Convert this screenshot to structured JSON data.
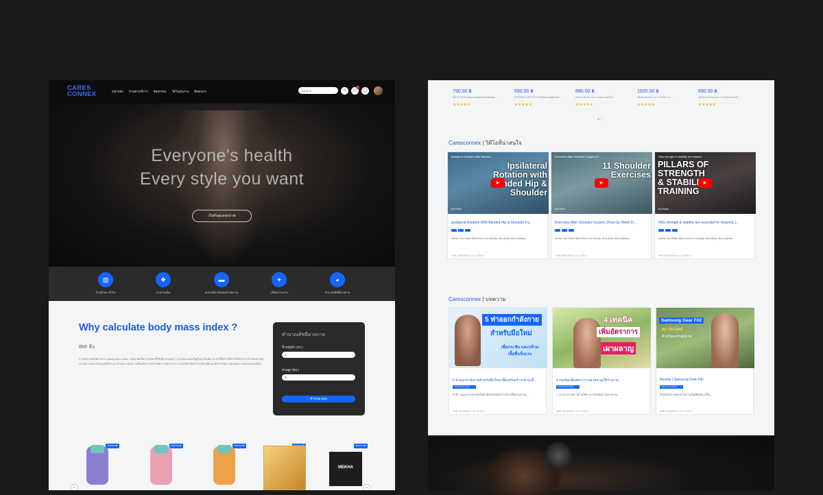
{
  "left": {
    "logo": {
      "line1": "CARES",
      "line2": "CONNEX"
    },
    "nav": {
      "menu": [
        "หน้าหลัก",
        "ร้านค้า/บริการ",
        "ศัลยกรรม",
        "วิดีโอสุขภาพ",
        "ติดต่อเรา"
      ],
      "search_placeholder": "Search",
      "notification_count": ""
    },
    "hero": {
      "line1": "Everyone's health",
      "line2": "Every style you want",
      "button": "เริ่มต้นดูแลสุขภาพ"
    },
    "categories": [
      {
        "icon": "first-aid-icon",
        "label": "ร้านค้า/ยา ทั่วไป"
      },
      {
        "icon": "capsule-icon",
        "label": "อาหารเสริม"
      },
      {
        "icon": "dumbbell-icon",
        "label": "อุปกรณ์สำหรับออกกำลังกาย"
      },
      {
        "icon": "puzzle-icon",
        "label": "เสริมความงาม"
      },
      {
        "icon": "bmi-icon",
        "label": "คำนวณดัชนีมวลกาย"
      }
    ],
    "bmi": {
      "heading": "Why calculate body mass index ?",
      "subheading": "BMI คือ",
      "paragraph": "การคำนวณดัชนีมวลกาย (Body Mass Index : BMI) คือเป็นการวัดค่าที่ใช้เพื่อประเมินภาวะอ้วนและผอมในผู้ใหญ่ ตั้งแต่อายุ 20 ปีขึ้นไป ซึ่งช่วยให้ทราบว่าน้ำหนักตัวของเราเหมาะสมกับส่วนสูงหรือไม่ และช่วยประเมินความเสี่ยงต่อการเกิดโรคต่างๆ ที่มาจากภาวะอ้วนได้ เพื่อนำไปปรับเปลี่ยนพฤติกรรมในการดูแลสุขภาพของตนเองต่อไป"
    },
    "calc": {
      "title": "คำนวณดัชนีมวลกาย",
      "weight_label": "น้ำหนักตัว (กก.)",
      "weight_value": "0",
      "height_label": "ส่วนสูง (ซม.)",
      "height_value": "0",
      "button": "คำนวณ BMI"
    },
    "products": [
      {
        "badge": "สินค้าขายดี",
        "type": "bottle",
        "color": "#8d7fd0"
      },
      {
        "badge": "สินค้าขายดี",
        "type": "bottle",
        "color": "#e7a1b3"
      },
      {
        "badge": "สินค้าขายดี",
        "type": "bottle",
        "color": "#f0a24a"
      },
      {
        "badge": "สินค้าขายดี",
        "type": "box",
        "color": "#e0a23a"
      },
      {
        "badge": "สินค้าขายดี",
        "type": "mekha",
        "color": "#1d1d1d",
        "label": "MEKHA"
      }
    ]
  },
  "right": {
    "products": [
      {
        "price": "790.00 ฿",
        "desc": "NOI EVTIRA Dietary Supplement includes...",
        "stars": "★★★★★"
      },
      {
        "price": "690.00 ฿",
        "desc": "EXTREME CARE PLUS Dietary Supplement...",
        "stars": "★★★★★"
      },
      {
        "price": "890.00 ฿",
        "desc": "ผลิตภัณฑ์เสริมอาหาร คอลลาเจนผิวใส...",
        "stars": "★★★★★"
      },
      {
        "price": "1920.00 ฿",
        "desc": "ผลิตภัณฑ์เสริมอาหาร วิตามินรวม...",
        "stars": "★★★★★"
      },
      {
        "price": "690.00 ฿",
        "desc": "ผลิตภัณฑ์เสริมอาหาร สารสกัดธรรมชาติ...",
        "stars": "★★★★★"
      }
    ],
    "videos_section": {
      "brand": "Caresconnex",
      "sep": " | ",
      "title": "วิดีโอที่น่าสนใจ"
    },
    "videos": [
      {
        "thumb_title": "Ipsilateral Rotation With Banded ...",
        "big": "Ipsilateral Rotation with Banded Hip & Shoulder",
        "title": "Ipsilateral Rotation With Banded Hip & Shoulder Fa...",
        "about": "About: The Peter Attia Drive is a weekly, ultra-deep-dive podcast...",
        "date": "วันที่: 29/03/2024 เวลา 12:56 น.",
        "yt_label": "YouTube"
      },
      {
        "thumb_title": "Exercises After Shoulder Surgery (P...",
        "big": "11 Shoulder Exercises",
        "title": "Exercises After Shoulder Surgery (Post-Op Week 9)...",
        "about": "About: The Peter Attia Drive is a weekly, ultra-deep-dive podcast...",
        "date": "วันที่: 29/03/2024 เวลา 12:55 น.",
        "yt_label": "YouTube"
      },
      {
        "thumb_title": "Why strength & stability are essenti...",
        "big": "PILLARS OF STRENGTH & STABILITY TRAINING",
        "title": "Why strength & stability are essential for longevity |...",
        "about": "About: The Peter Attia Drive is a weekly, ultra-deep-dive podcast...",
        "date": "วันที่: 29/03/2024 เวลา 12:55 น.",
        "yt_label": "YouTube"
      }
    ],
    "articles_section": {
      "brand": "Caresconnex",
      "sep": " | ",
      "title": "บทความ"
    },
    "articles": [
      {
        "overlay1": "5 ท่าออกกำลังกาย",
        "overlay2": "สำหรับมือใหม่",
        "overlay3": "เพื่อกระชับ และกล้ามเนื้อที่แข็งแรง",
        "title": "5 ท่าออกกำลังกายสำหรับมือใหม่ เพื่อเสริมสร้างกล้ามเนื้...",
        "tag": "Caresconnex Admin",
        "desc": "ท่าที่ 1 Squat ท่าสควอทเป็นท่าที่ช่วยเสริมสร้างกล้ามเนื้อขาและก้น...",
        "date": "วันที่: 29/03/2024 เวลา 11:40 น."
      },
      {
        "overlay1": "4 เทคนิค",
        "overlay2": "เพิ่มอัตราการ",
        "overlay3": "เผาผลาญ",
        "title": "4 เทคนิคเพิ่มอัตราการเผาผลาญให้ร่างกาย",
        "tag": "Caresconnex Admin",
        "desc": "1. ทานอาหารเช้า มีส่วนให้ร่างกายเริ่มต้นการเผาผลาญ...",
        "date": "วันที่: 29/03/2024 เวลา 11:35 น."
      },
      {
        "overlay1": "Samsung Gear Fit2",
        "overlay2": "สมาร์ทวอทช์",
        "overlay3": "สำหรับคนรักสุขภาพ",
        "title": "Review | Samsung Gear Fit2",
        "tag": "Caresconnex Admin",
        "desc": "ในปัจจุบันการออกกำลังกายเป็นที่นิยมมากขึ้น...",
        "date": "วันที่: 29/03/2024 เวลา 11:30 น."
      }
    ]
  }
}
